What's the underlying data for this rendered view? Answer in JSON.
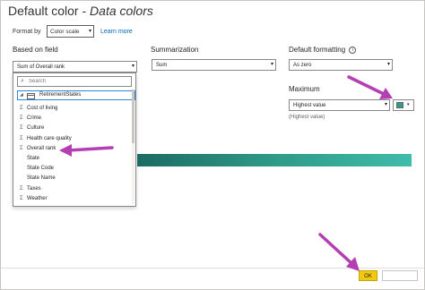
{
  "dialog": {
    "title_main": "Default color - ",
    "title_sub": "Data colors"
  },
  "format_by": {
    "label": "Format by",
    "value": "Color scale",
    "learn_more": "Learn more"
  },
  "based_on_field": {
    "heading": "Based on field",
    "value": "Sum of Overall rank",
    "search_placeholder": "Search",
    "table_name": "RetirementStates",
    "fields": [
      {
        "label": "Cost of living",
        "sigma": true
      },
      {
        "label": "Crime",
        "sigma": true
      },
      {
        "label": "Culture",
        "sigma": true
      },
      {
        "label": "Health care quality",
        "sigma": true
      },
      {
        "label": "Overall rank",
        "sigma": true
      },
      {
        "label": "State",
        "sigma": false
      },
      {
        "label": "State Code",
        "sigma": false
      },
      {
        "label": "State Name",
        "sigma": false
      },
      {
        "label": "Taxes",
        "sigma": true
      },
      {
        "label": "Weather",
        "sigma": true
      }
    ],
    "sigma_glyph": "Σ"
  },
  "summarization": {
    "heading": "Summarization",
    "value": "Sum"
  },
  "default_formatting": {
    "heading": "Default formatting",
    "info_glyph": "i",
    "value": "As zero"
  },
  "maximum": {
    "heading": "Maximum",
    "value": "Highest value",
    "display": "(Highest value)",
    "color": "#2e9c8b"
  },
  "gradient": {
    "start_color": "#1c6b63",
    "mid_color": "#2f9a88",
    "end_color": "#3fbcaa"
  },
  "footer": {
    "ok_label": "OK",
    "ok_color": "#f2c811"
  },
  "annotations": {
    "arrow_color": "#b43fb3"
  }
}
